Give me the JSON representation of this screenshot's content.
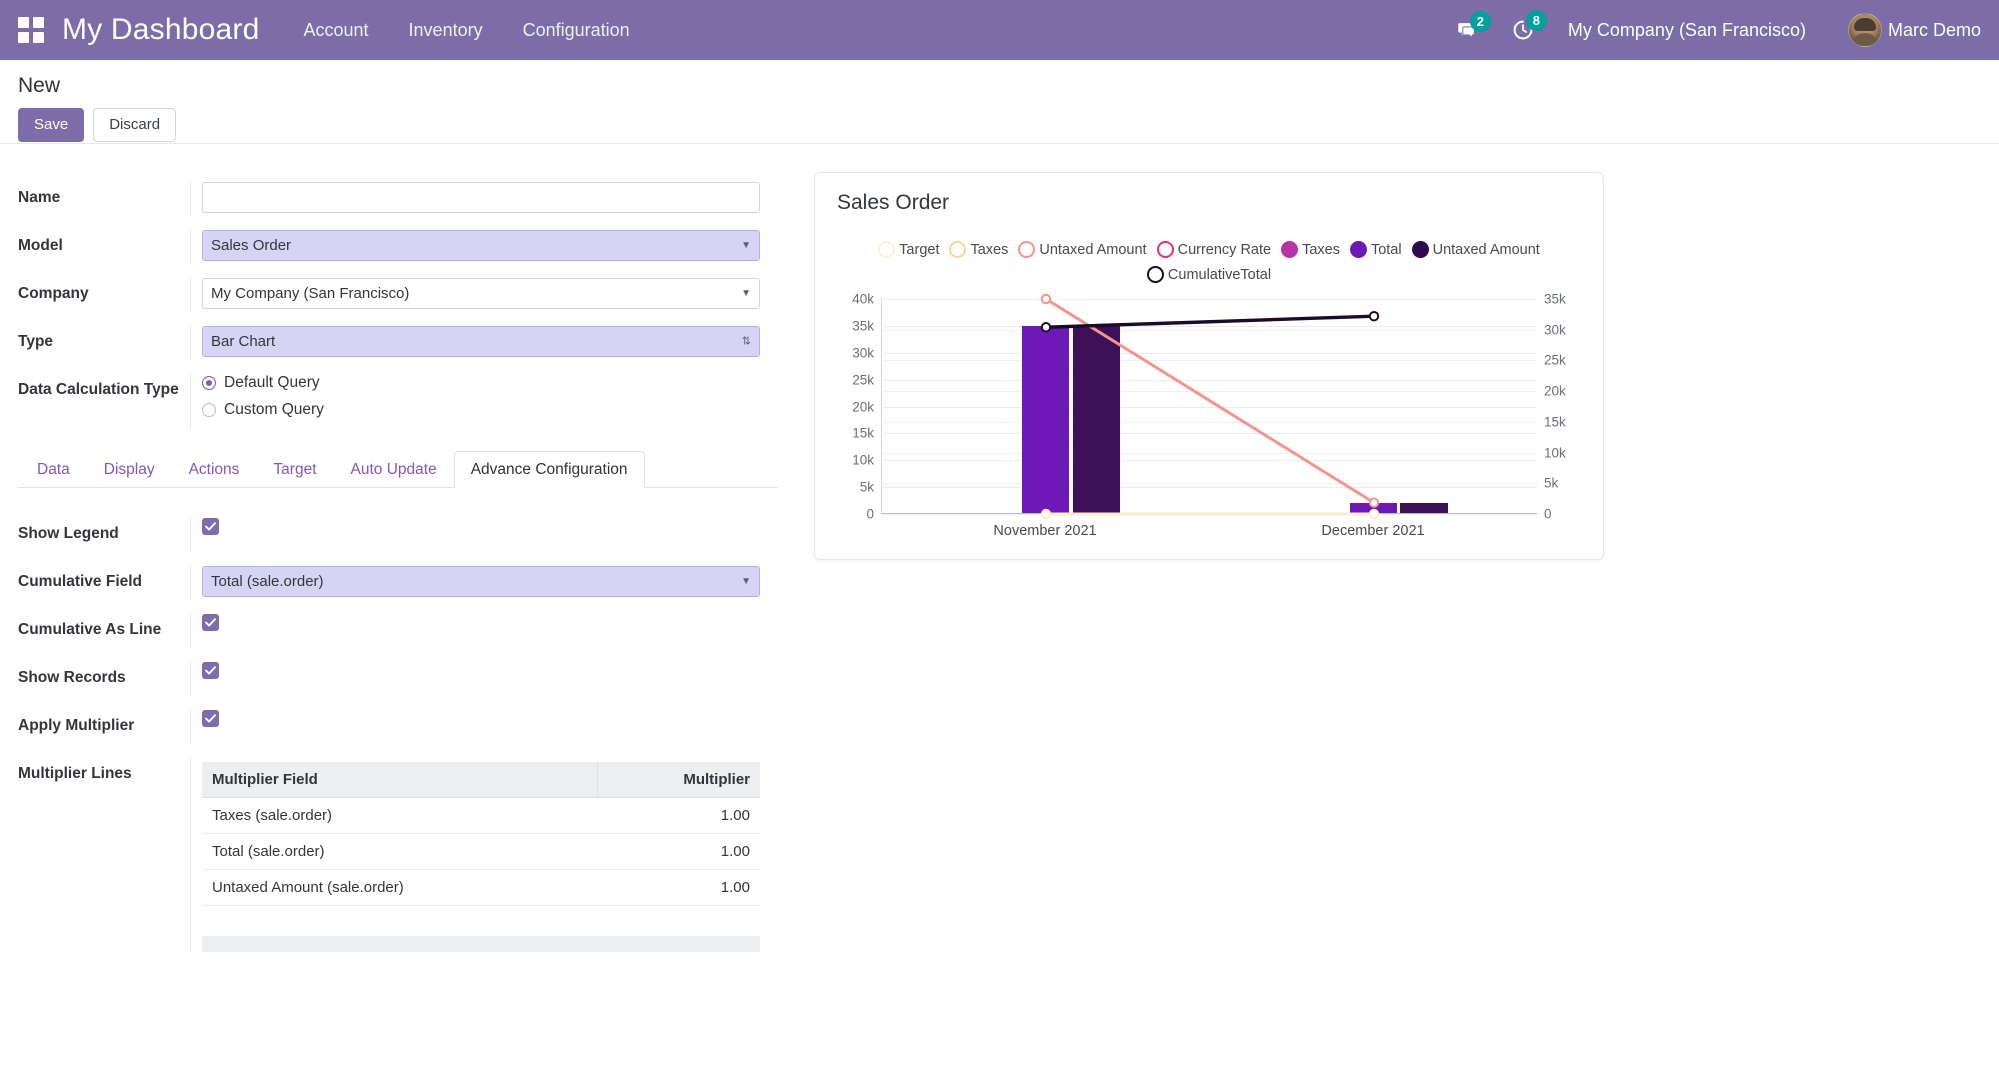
{
  "navbar": {
    "apps_icon": "apps-grid-icon",
    "brand": "My Dashboard",
    "links": [
      {
        "label": "Account"
      },
      {
        "label": "Inventory"
      },
      {
        "label": "Configuration"
      }
    ],
    "messages_icon": "chat-bubble-icon",
    "messages_count": "2",
    "activities_icon": "clock-icon",
    "activities_count": "8",
    "company": "My Company (San Francisco)",
    "user_name": "Marc Demo",
    "avatar_icon": "avatar",
    "bg_color": "#7c6ca8"
  },
  "control_panel": {
    "title": "New",
    "save_label": "Save",
    "discard_label": "Discard"
  },
  "form": {
    "fields": [
      {
        "label": "Name",
        "value": "",
        "placeholder": ""
      },
      {
        "label": "Model",
        "value": "Sales Order"
      },
      {
        "label": "Company",
        "value": "My Company (San Francisco)"
      },
      {
        "label": "Type",
        "value": "Bar Chart"
      }
    ],
    "name_label": "Name",
    "name_value": "",
    "model_label": "Model",
    "model_value": "Sales Order",
    "company_label": "Company",
    "company_value": "My Company (San Francisco)",
    "type_label": "Type",
    "type_value": "Bar Chart",
    "data_calc_label": "Data Calculation Type",
    "radio_default": "Default Query",
    "radio_custom": "Custom Query",
    "radio_selected": "Default Query"
  },
  "notebook": {
    "tabs": [
      {
        "label": "Data",
        "active": false
      },
      {
        "label": "Display",
        "active": false
      },
      {
        "label": "Actions",
        "active": false
      },
      {
        "label": "Target",
        "active": false
      },
      {
        "label": "Auto Update",
        "active": false
      },
      {
        "label": "Advance Configuration",
        "active": true
      }
    ]
  },
  "advance_config": {
    "show_legend_label": "Show Legend",
    "show_legend_checked": true,
    "cumulative_field_label": "Cumulative Field",
    "cumulative_field_value": "Total (sale.order)",
    "cumulative_as_line_label": "Cumulative As Line",
    "cumulative_as_line_checked": true,
    "show_records_label": "Show Records",
    "show_records_checked": true,
    "apply_multiplier_label": "Apply Multiplier",
    "apply_multiplier_checked": true,
    "multiplier_lines_label": "Multiplier Lines",
    "table": {
      "columns": [
        "Multiplier Field",
        "Multiplier"
      ],
      "rows": [
        {
          "field": "Taxes (sale.order)",
          "multiplier": "1.00"
        },
        {
          "field": "Total (sale.order)",
          "multiplier": "1.00"
        },
        {
          "field": "Untaxed Amount (sale.order)",
          "multiplier": "1.00"
        }
      ]
    }
  },
  "chart_data": {
    "type": "bar",
    "title": "Sales Order",
    "xlabel": "",
    "ylabel": "",
    "categories": [
      "November 2021",
      "December 2021"
    ],
    "ylim": [
      0,
      40000
    ],
    "y2lim": [
      0,
      35000
    ],
    "ytick_labels": [
      "0",
      "5k",
      "10k",
      "15k",
      "20k",
      "25k",
      "30k",
      "35k",
      "40k"
    ],
    "ytick_values": [
      0,
      5000,
      10000,
      15000,
      20000,
      25000,
      30000,
      35000,
      40000
    ],
    "y2tick_labels": [
      "0",
      "5k",
      "10k",
      "15k",
      "20k",
      "25k",
      "30k",
      "35k"
    ],
    "y2tick_values": [
      0,
      5000,
      10000,
      15000,
      20000,
      25000,
      30000,
      35000
    ],
    "grid": true,
    "legend_position": "top",
    "legend": [
      {
        "name": "Target",
        "color": "#fdf0d5",
        "style": "ring"
      },
      {
        "name": "Taxes",
        "color": "#fbd59a",
        "style": "ring"
      },
      {
        "name": "Untaxed Amount",
        "color": "#f4948c",
        "style": "ring"
      },
      {
        "name": "Currency Rate",
        "color": "#ec2f6a",
        "style": "ring"
      },
      {
        "name": "Taxes",
        "color": "#b833a8",
        "style": "solid"
      },
      {
        "name": "Total",
        "color": "#6d19b5",
        "style": "solid"
      },
      {
        "name": "Untaxed Amount",
        "color": "#2f0a4c",
        "style": "solid"
      },
      {
        "name": "CumulativeTotal",
        "color": "#1b0a2a",
        "style": "ring"
      }
    ],
    "series": [
      {
        "name": "Taxes",
        "kind": "bar",
        "color": "#b833a8",
        "axis": "left",
        "values": [
          0,
          0
        ]
      },
      {
        "name": "Total",
        "kind": "bar",
        "color": "#6d19b5",
        "axis": "left",
        "values": [
          34800,
          1900
        ]
      },
      {
        "name": "Untaxed Amount",
        "kind": "bar",
        "color": "#3d1158",
        "axis": "left",
        "values": [
          34800,
          1900
        ]
      },
      {
        "name": "Target",
        "kind": "line",
        "color": "#fdecc8",
        "axis": "left",
        "values": [
          0,
          0
        ]
      },
      {
        "name": "Currency Rate",
        "kind": "line",
        "color": "#f4948c",
        "axis": "left",
        "values": [
          40000,
          2100
        ]
      },
      {
        "name": "CumulativeTotal",
        "kind": "line",
        "color": "#1b0a2a",
        "axis": "right",
        "values": [
          30400,
          32200
        ]
      }
    ]
  }
}
